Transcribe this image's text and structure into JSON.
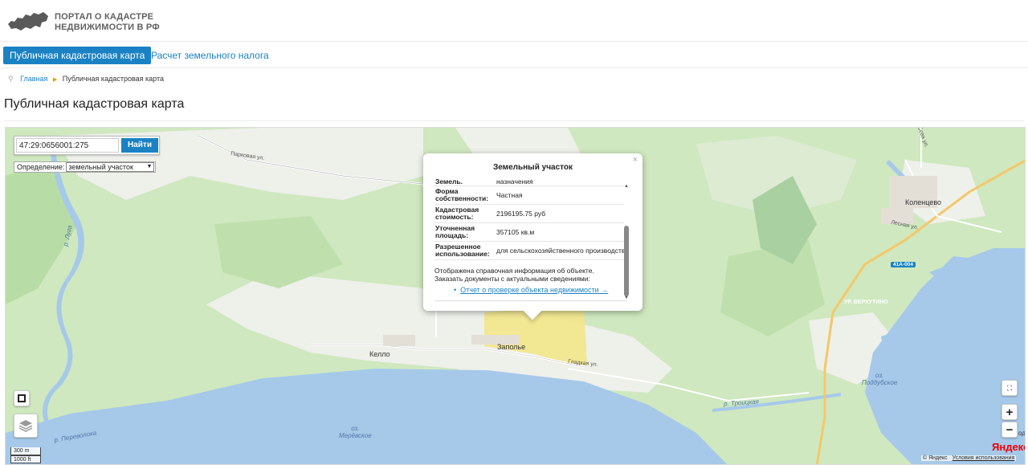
{
  "header": {
    "logo_line1": "ПОРТАЛ О КАДАСТРЕ",
    "logo_line2": "НЕДВИЖИМОСТИ В РФ"
  },
  "nav": {
    "tab_active": "Публичная кадастровая карта",
    "tab_link": "Расчет земельного налога"
  },
  "breadcrumb": {
    "home": "Главная",
    "current": "Публичная кадастровая карта"
  },
  "page": {
    "title": "Публичная кадастровая карта"
  },
  "search": {
    "value": "47:29:0656001:275",
    "button": "Найти",
    "def_label": "Определение:",
    "def_value": "земельный участок"
  },
  "popup": {
    "title": "Земельный участок",
    "cut_key": "Земель.",
    "cut_value": "назначения",
    "rows": [
      {
        "key": "Форма собственности:",
        "value": "Частная"
      },
      {
        "key": "Кадастровая стоимость:",
        "value": "2196195.75 руб"
      },
      {
        "key": "Уточненная площадь:",
        "value": "357105 кв.м"
      },
      {
        "key": "Разрешенное использование:",
        "value": "для сельскохозяйственного производства"
      }
    ],
    "notice": "Отображена справочная информация об объекте. Заказать документы с актуальными сведениями:",
    "link": "Отчет о проверке объекта недвижимости →"
  },
  "map": {
    "places": {
      "kello": "Келло",
      "zapolye": "Заполье",
      "kolentsevo": "Коленцево"
    },
    "streets": {
      "parkovaya": "Парковая ул.",
      "gladkaya": "Гладкая ул.",
      "lesnaya": "Лесная ул.",
      "verkhutino": "УР. ВЕРХУТИНО",
      "seva": "Сева ул."
    },
    "water": {
      "luga": "р. Луга",
      "perevoloka": "р. Переволока",
      "troitskaya": "р. Троицкая",
      "merevskoe_prefix": "оз.",
      "merevskoe": "Мерёвское",
      "poddubskoe_prefix": "оз.",
      "poddubskoe": "Поддубское"
    },
    "road_badge": "41А-004",
    "edge_label": "од",
    "scale_m": "300 m",
    "scale_ft": "1000 ft",
    "logo": "Яндекс",
    "copyright": "© Яндекс",
    "terms": "Условия использования",
    "zoom_in": "+",
    "zoom_out": "−"
  }
}
